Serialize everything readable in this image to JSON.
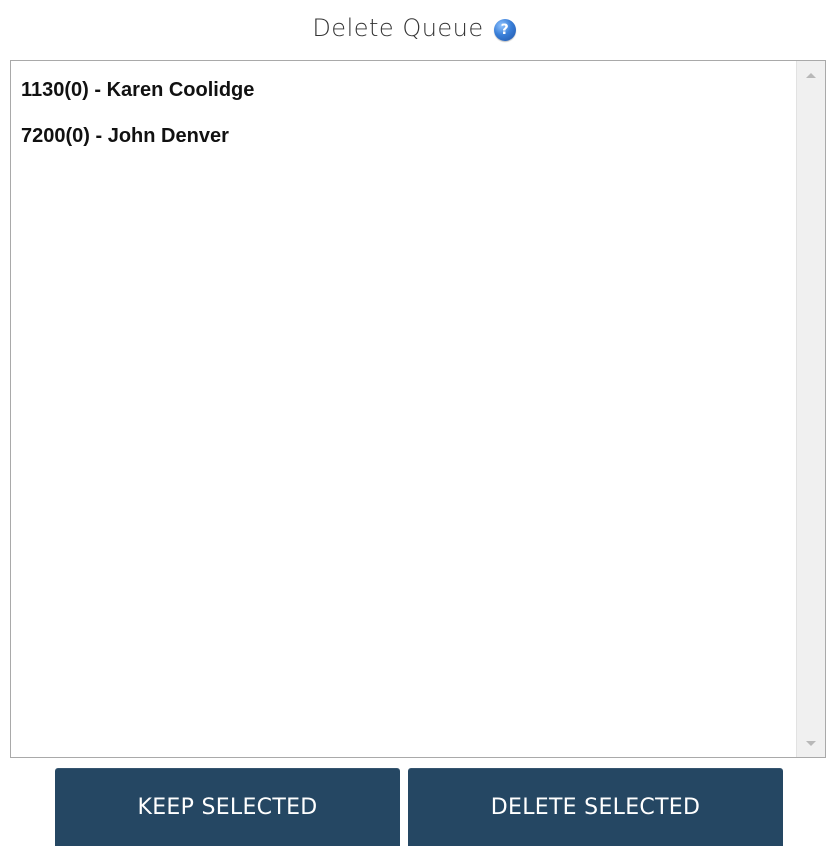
{
  "header": {
    "title": "Delete Queue",
    "help_icon": "?"
  },
  "queue": {
    "items": [
      {
        "label": "1130(0) - Karen Coolidge"
      },
      {
        "label": "7200(0) - John Denver"
      }
    ]
  },
  "actions": {
    "keep_label": "KEEP SELECTED",
    "delete_label": "DELETE SELECTED"
  },
  "icons": {
    "help": "help-circle-icon",
    "scroll_up": "chevron-up-icon",
    "scroll_down": "chevron-down-icon"
  },
  "colors": {
    "button_bg": "#254763",
    "button_text": "#ffffff",
    "help_icon": "#3a7fd8",
    "list_border": "#a9a9a9"
  }
}
